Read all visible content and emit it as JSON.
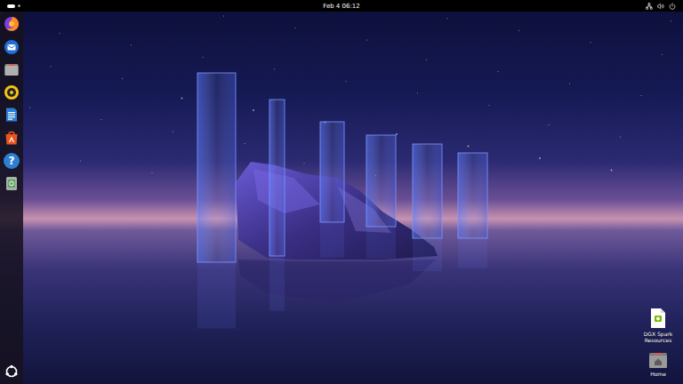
{
  "top_bar": {
    "clock": "Feb 4 06:12",
    "tray": [
      {
        "kind": "network"
      },
      {
        "kind": "volume"
      },
      {
        "kind": "power"
      }
    ]
  },
  "dock": {
    "items": [
      {
        "kind": "firefox"
      },
      {
        "kind": "thunderbird"
      },
      {
        "kind": "files"
      },
      {
        "kind": "rhythmbox"
      },
      {
        "kind": "writer"
      },
      {
        "kind": "appcenter"
      },
      {
        "kind": "help",
        "glyph": "?"
      },
      {
        "kind": "trash"
      }
    ],
    "show_apps": {
      "kind": "ubuntu"
    }
  },
  "desktop_icons": [
    {
      "label": "DGX Spark Resources",
      "kind": "file"
    },
    {
      "label": "Home",
      "kind": "folder"
    }
  ]
}
